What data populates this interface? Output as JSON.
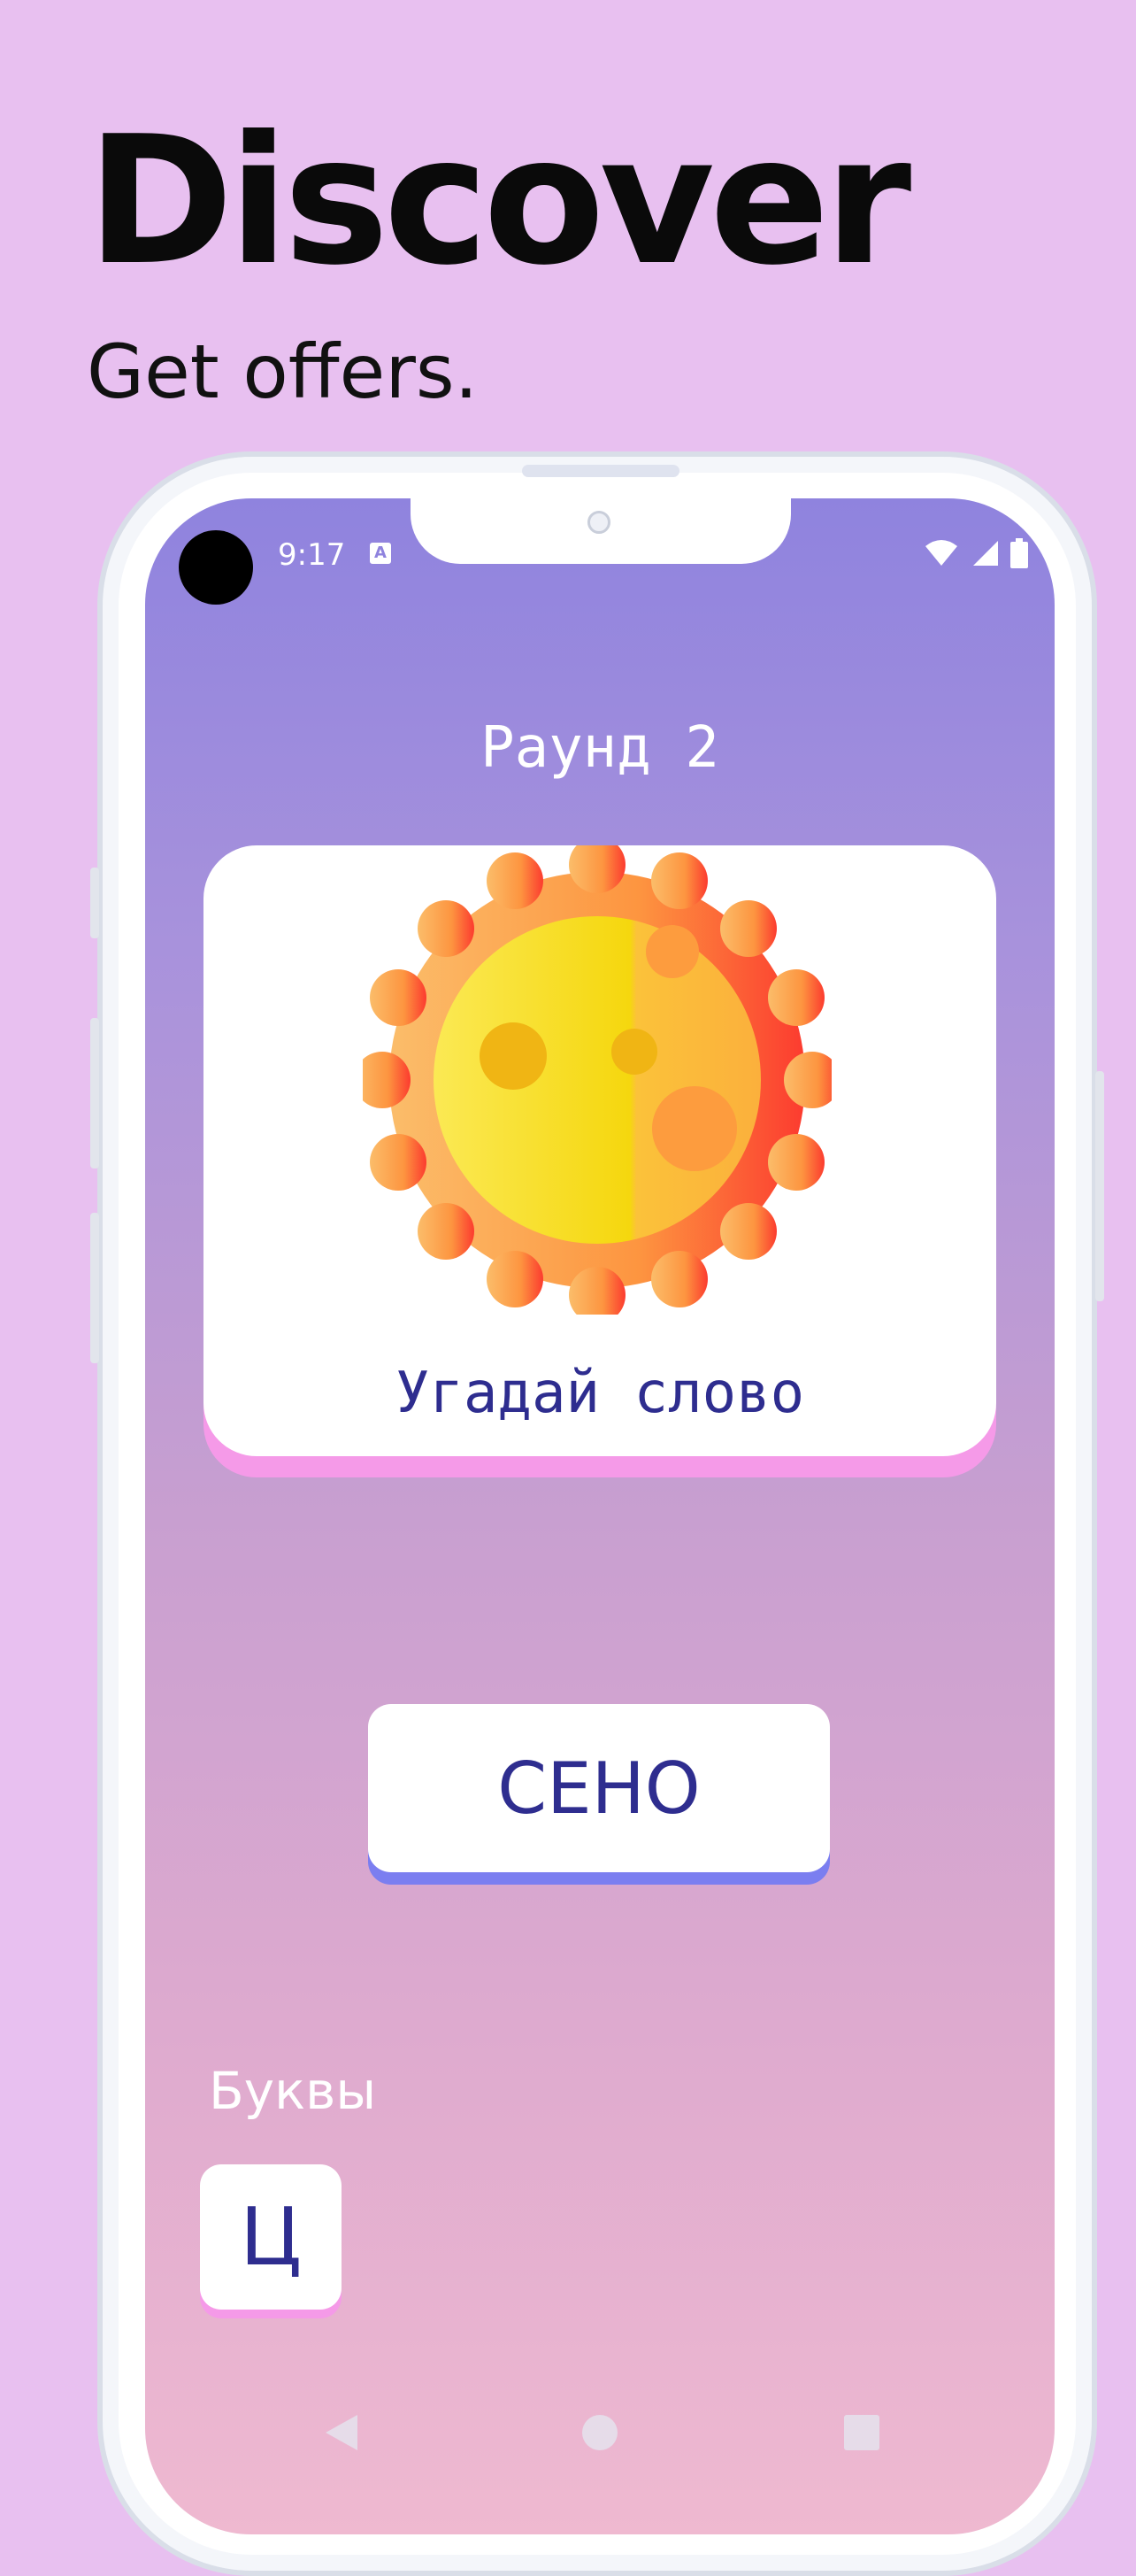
{
  "promo": {
    "headline": "Discover",
    "subheadline": "Get offers."
  },
  "status_bar": {
    "time": "9:17",
    "notification_icon": "A",
    "icons": [
      "wifi-icon",
      "signal-icon",
      "battery-icon"
    ]
  },
  "game": {
    "round_title": "Раунд 2",
    "card_caption": "Угадай слово",
    "card_image": "sun-icon",
    "answer": "СЕНО",
    "letters_label": "Буквы",
    "letters": [
      "Ц"
    ]
  },
  "nav": {
    "icons": [
      "back-icon",
      "home-icon",
      "recents-icon"
    ]
  },
  "colors": {
    "page_background": "#e8c0f0",
    "gradient_top": "#8f83de",
    "gradient_bottom": "#efb9d0",
    "text_dark_blue": "#2e2d8f",
    "card_shadow_pink": "#f59ae8",
    "answer_shadow_blue": "#7b7ef0"
  }
}
